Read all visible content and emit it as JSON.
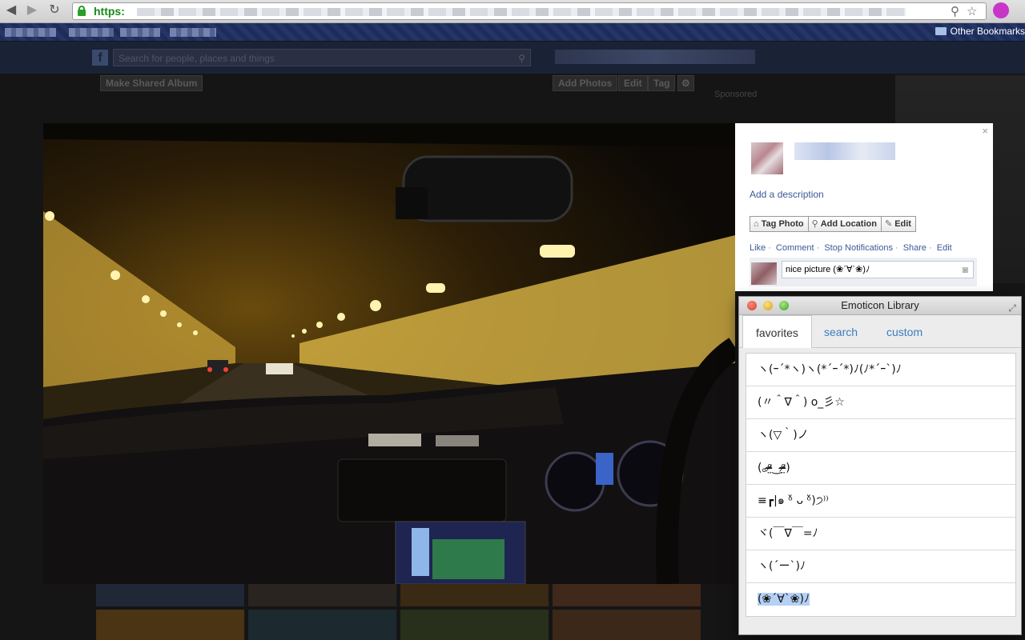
{
  "browser": {
    "back_icon": "back-arrow-icon",
    "scheme": "https:",
    "other_bookmarks": "Other Bookmarks"
  },
  "facebook": {
    "logo": "f",
    "search_placeholder": "Search for people, places and things",
    "buttons": {
      "make_shared_album": "Make Shared Album",
      "add_photos": "Add Photos",
      "edit": "Edit",
      "tag": "Tag"
    },
    "sponsored": "Sponsored"
  },
  "photo_panel": {
    "close": "×",
    "add_description": "Add a description",
    "actions": {
      "tag_photo": "Tag Photo",
      "add_location": "Add Location",
      "edit": "Edit"
    },
    "links": [
      "Like",
      "Comment",
      "Stop Notifications",
      "Share",
      "Edit"
    ],
    "comment_value": "nice picture (❀ˊ∀ˋ❀)ﾉ"
  },
  "emoticon_library": {
    "title": "Emoticon Library",
    "tabs": [
      "favorites",
      "search",
      "custom"
    ],
    "active_tab": "favorites",
    "items": [
      "ヽ(ｰ´*ヽ)ヽ(*´ｰ´*)ﾉ(ﾉ*´ｰ`)ﾉ",
      "(〃＾∇＾) o_彡☆",
      "ヽ(▽｀)ノ",
      "(｡ᵒ̴̶̷̤‿ᵒ̴̶̷̤)",
      "≡┏|๑ ᵒ̌ ᴗ ᵒ̌)੭⁾⁾",
      "ヾ(￣∇￣=ﾉ",
      "ヽ(´ー`)ﾉ",
      "(❀ˊ∀ˋ❀)ﾉ"
    ],
    "selected_index": 7
  },
  "colors": {
    "fb_link": "#3b5998",
    "tab_link": "#3d7cc0",
    "selection": "#b4d0f4"
  }
}
